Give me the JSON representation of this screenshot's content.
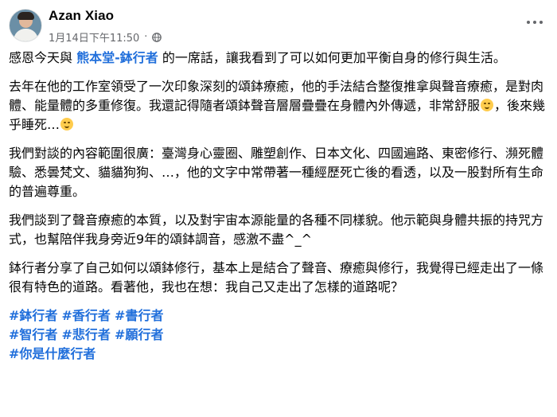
{
  "post": {
    "author": "Azan Xiao",
    "timestamp": "1月14日下午11:50",
    "separator": "·",
    "privacy_icon": "globe-icon",
    "more_icon": "more-options-icon"
  },
  "content": {
    "p1_before": "感恩今天與 ",
    "p1_link": "熊本堂-鉢行者",
    "p1_after": " 的一席話，讓我看到了可以如何更加平衡自身的修行與生活。",
    "p2_text": "去年在他的工作室領受了一次印象深刻的頌鉢療癒，他的手法結合整復推拿與聲音療癒，是對肉體、能量體的多重修復。我還記得隨者頌鉢聲音層層疊疊在身體內外傳遞，非常舒服",
    "p2_mid": "，後來幾乎睡死…",
    "p2_emoji1": "sleepy-face-emoji",
    "p2_emoji2": "rolling-laughing-emoji",
    "p3_text": "我們對談的內容範圍很廣：臺灣身心靈圈、雕塑創作、日本文化、四國遍路、東密修行、瀕死體驗、悉曇梵文、貓貓狗狗、…，他的文字中常帶著一種經歷死亡後的看透，以及一股對所有生命的普遍尊重。",
    "p4_text": "我們談到了聲音療癒的本質，以及對宇宙本源能量的各種不同樣貌。他示範與身體共振的持咒方式，也幫陪伴我身旁近9年的頌鉢調音，感激不盡^_^",
    "p5_text": "鉢行者分享了自己如何以頌鉢修行，基本上是結合了聲音、療癒與修行，我覺得已經走出了一條很有特色的道路。看著他，我也在想：我自己又走出了怎樣的道路呢？",
    "hashtags": [
      "#鉢行者",
      "#香行者",
      "#書行者",
      "#智行者",
      "#悲行者",
      "#願行者",
      "#你是什麼行者"
    ]
  }
}
